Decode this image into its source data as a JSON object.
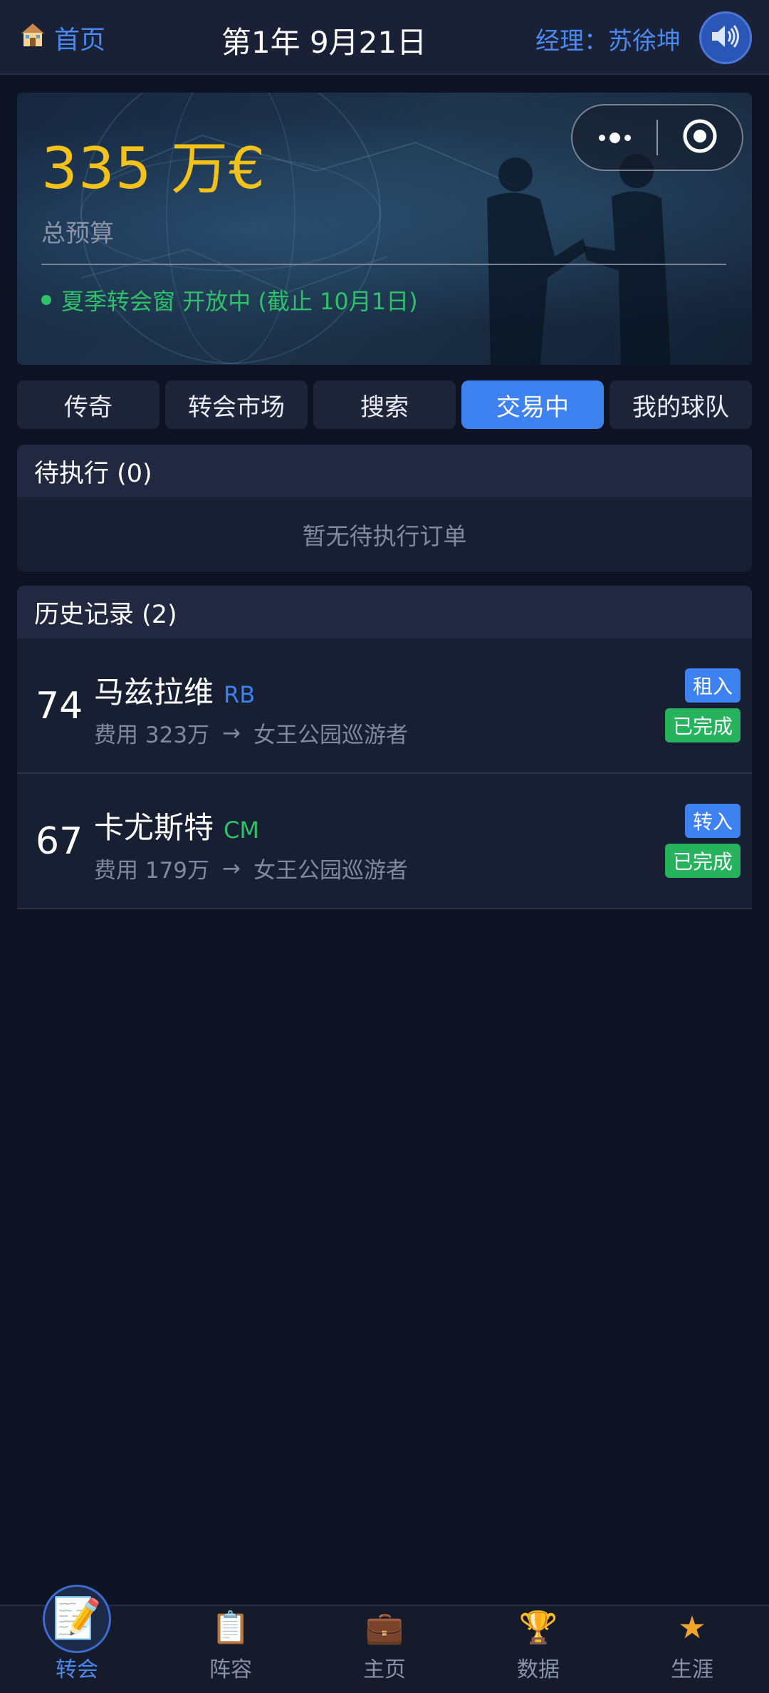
{
  "header": {
    "home_label": "首页",
    "date": "第1年 9月21日",
    "manager": "经理：苏徐坤"
  },
  "hero": {
    "budget": "335 万€",
    "budget_label": "总预算",
    "window_status": "夏季转会窗 开放中 (截止 10月1日)"
  },
  "tabs": [
    {
      "label": "传奇"
    },
    {
      "label": "转会市场"
    },
    {
      "label": "搜索"
    },
    {
      "label": "交易中",
      "active": true
    },
    {
      "label": "我的球队"
    }
  ],
  "pending": {
    "title": "待执行 (0)",
    "empty_text": "暂无待执行订单"
  },
  "history": {
    "title": "历史记录 (2)",
    "rows": [
      {
        "rating": "74",
        "name": "马兹拉维",
        "position": "RB",
        "fee": "费用 323万",
        "arrow": "→",
        "club": "女王公园巡游者",
        "type": "租入",
        "status": "已完成"
      },
      {
        "rating": "67",
        "name": "卡尤斯特",
        "position": "CM",
        "fee": "费用 179万",
        "arrow": "→",
        "club": "女王公园巡游者",
        "type": "转入",
        "status": "已完成"
      }
    ]
  },
  "bottom_nav": [
    {
      "label": "转会",
      "icon": "memo-icon",
      "active": true
    },
    {
      "label": "阵容",
      "icon": "clipboard-icon"
    },
    {
      "label": "主页",
      "icon": "briefcase-icon"
    },
    {
      "label": "数据",
      "icon": "trophy-icon"
    },
    {
      "label": "生涯",
      "icon": "star-icon"
    }
  ],
  "colors": {
    "accent": "#3d82f0",
    "budget": "#f3c21a",
    "success": "#27b35e",
    "position_rb": "#3d82f0",
    "position_cm": "#2ec16a"
  }
}
